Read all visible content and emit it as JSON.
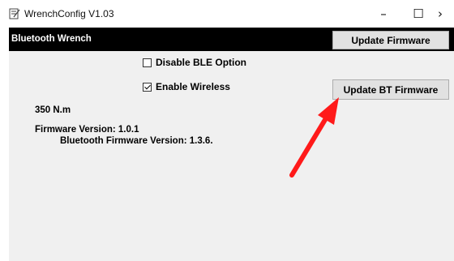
{
  "window": {
    "title": "WrenchConfig V1.03",
    "icon": "notepad-edit-icon",
    "controls": {
      "minimize": "–",
      "maximize": "☐",
      "close": "›"
    }
  },
  "header": {
    "title": "Bluetooth Wrench",
    "update_firmware_label": "Update Firmware"
  },
  "options": {
    "disable_ble": {
      "label": "Disable BLE Option",
      "checked": false
    },
    "enable_wireless": {
      "label": "Enable Wireless",
      "checked": true
    }
  },
  "actions": {
    "update_bt_firmware_label": "Update BT Firmware"
  },
  "info": {
    "torque": "350 N.m",
    "firmware_version": "Firmware Version: 1.0.1",
    "bt_firmware_version": "Bluetooth Firmware Version: 1.3.6."
  },
  "annotation": {
    "arrow_color": "#ff1a1a",
    "icon": "red-arrow-icon"
  },
  "colors": {
    "header_bg": "#000000",
    "content_bg": "#f0f0f0",
    "button_bg": "#e1e1e1"
  }
}
